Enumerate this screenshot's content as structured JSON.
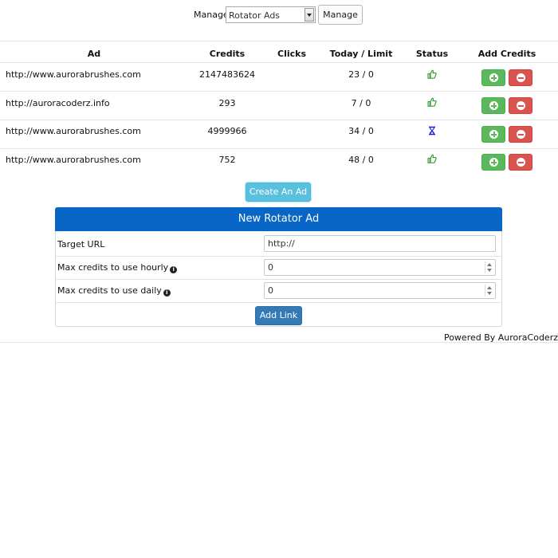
{
  "manage": {
    "label": "Manage:",
    "selected": "Rotator Ads",
    "button_label": "Manage"
  },
  "table": {
    "headers": [
      "Ad",
      "Credits",
      "Clicks",
      "Today / Limit",
      "Status",
      "Add Credits"
    ],
    "rows": [
      {
        "ad": "http://www.aurorabrushes.com",
        "credits": "2147483624",
        "clicks": "",
        "today_limit": "23 / 0",
        "status": "thumbs-up-icon"
      },
      {
        "ad": "http://auroracoderz.info",
        "credits": "293",
        "clicks": "",
        "today_limit": "7 / 0",
        "status": "thumbs-up-icon"
      },
      {
        "ad": "http://www.aurorabrushes.com",
        "credits": "4999966",
        "clicks": "",
        "today_limit": "34 / 0",
        "status": "hourglass-icon"
      },
      {
        "ad": "http://www.aurorabrushes.com",
        "credits": "752",
        "clicks": "",
        "today_limit": "48 / 0",
        "status": "thumbs-up-icon"
      }
    ]
  },
  "create_button": "Create An Ad",
  "form": {
    "title": "New Rotator Ad",
    "fields": [
      {
        "label": "Target URL",
        "value": "",
        "placeholder": "http://"
      },
      {
        "label": "Max credits to use hourly",
        "value": "0"
      },
      {
        "label": "Max credits to use daily",
        "value": "0"
      }
    ],
    "submit_label": "Add Link"
  },
  "footer": "Powered By AuroraCoderz",
  "colors": {
    "panel_header": "#0866c6",
    "add_button": "#5cb85c",
    "remove_button": "#d9534f",
    "create_button": "#5bc0de",
    "submit_button": "#337ab7",
    "status_active": "#2e9a2e",
    "status_pending": "#1a1ae6"
  }
}
